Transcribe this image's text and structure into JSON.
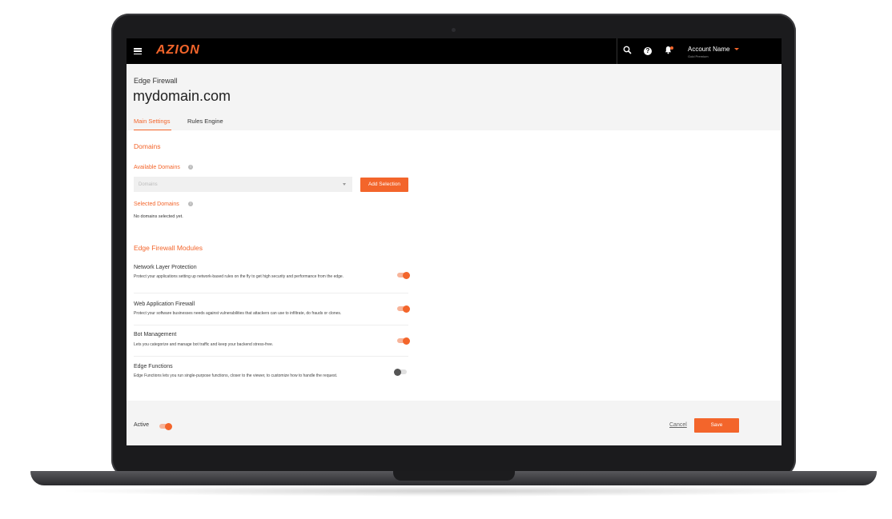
{
  "brand": {
    "logo": "AZION",
    "accent_color": "#f3652b"
  },
  "header": {
    "account_name": "Account Name",
    "account_plan": "Gold Premium",
    "icons": [
      "menu-icon",
      "search-icon",
      "help-icon",
      "bell-icon",
      "chevron-down-icon"
    ]
  },
  "page": {
    "section": "Edge Firewall",
    "title": "mydomain.com",
    "tabs": [
      {
        "label": "Main Settings",
        "active": true
      },
      {
        "label": "Rules Engine",
        "active": false
      }
    ]
  },
  "domains": {
    "heading": "Domains",
    "available_label": "Available Domains",
    "select_placeholder": "Domains",
    "add_button": "Add Selection",
    "selected_label": "Selected Domains",
    "empty_text": "No domains selected yet."
  },
  "modules": {
    "heading": "Edge Firewall Modules",
    "items": [
      {
        "title": "Network Layer Protection",
        "description": "Protect your applications setting up network-based rules on the fly to get high security and performance from the edge.",
        "enabled": true
      },
      {
        "title": "Web Application Firewall",
        "description": "Protect your software businesses needs against vulnerabilities that attackers can use to infiltrate, do frauds or clones.",
        "enabled": true
      },
      {
        "title": "Bot Management",
        "description": "Lets you categorize and manage bot traffic and keep your backend stress-free.",
        "enabled": true
      },
      {
        "title": "Edge Functions",
        "description": "Edge Functions lets you run single-purpose functions, closer to the viewer, to customize how to handle the request.",
        "enabled": false
      }
    ]
  },
  "footer": {
    "active_label": "Active",
    "active_enabled": true,
    "cancel_label": "Cancel",
    "save_label": "Save"
  }
}
